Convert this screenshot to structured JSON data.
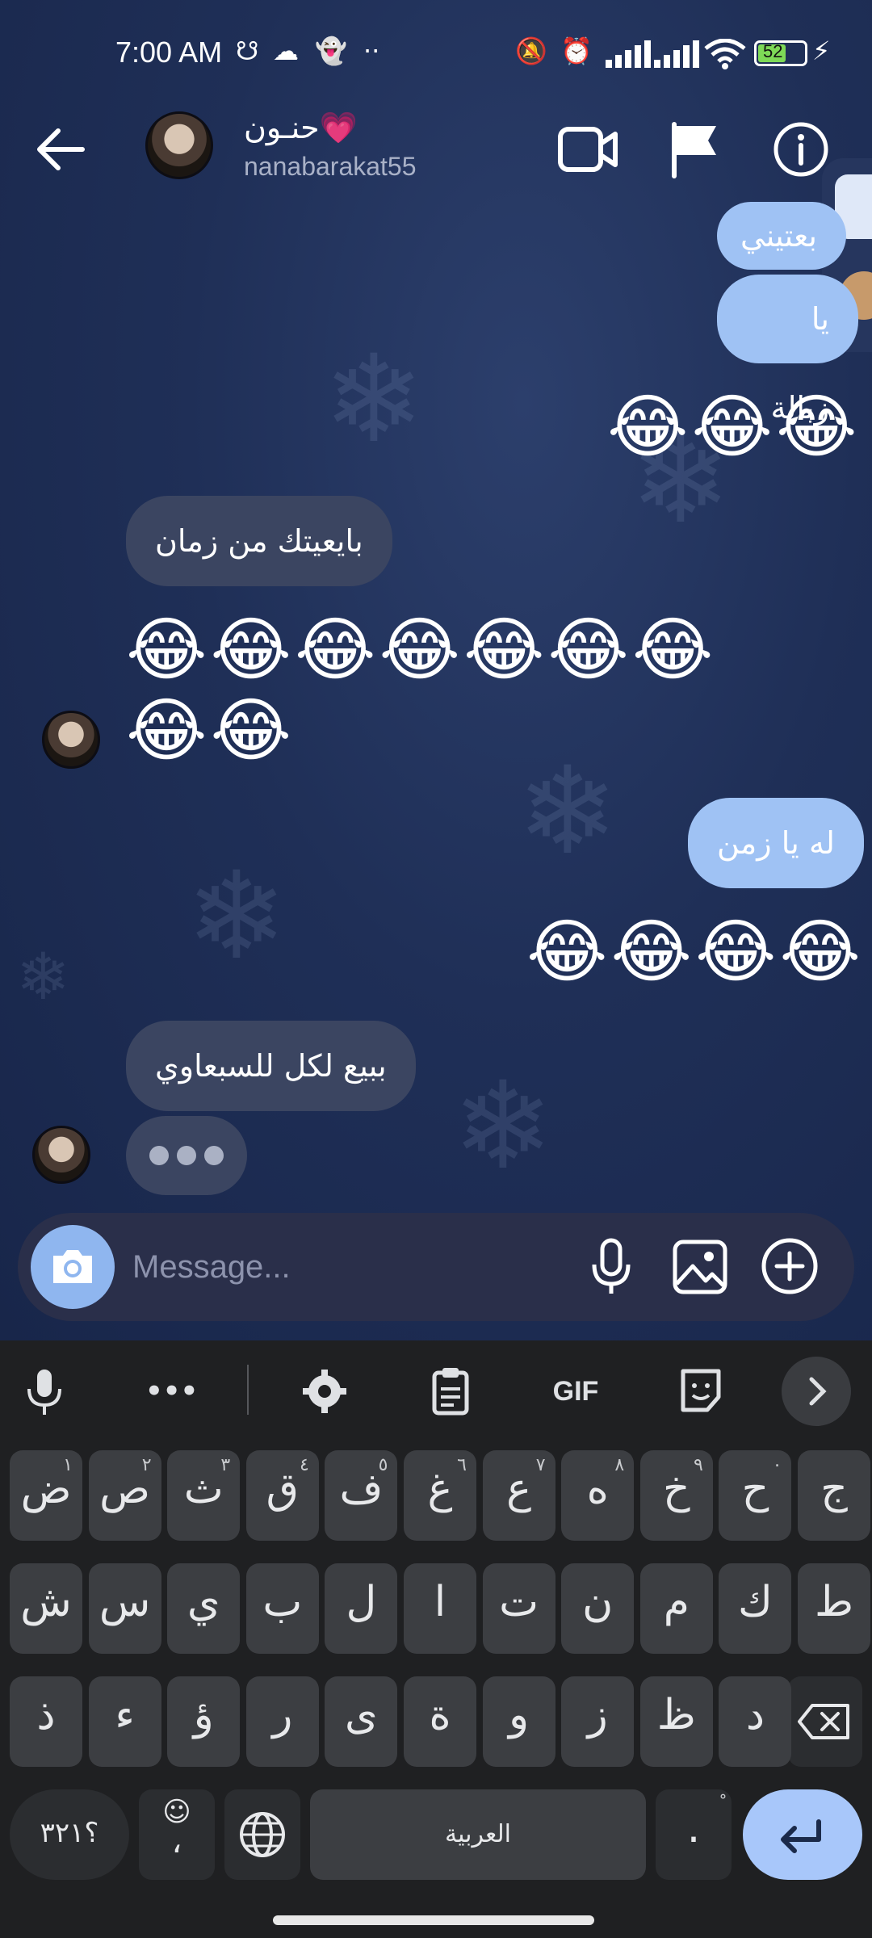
{
  "status_bar": {
    "time": "7:00 AM",
    "battery": "52"
  },
  "header": {
    "contact_name": "حنـون💗",
    "contact_username": "nanabarakat55"
  },
  "messages": {
    "out_1": "بعتيني",
    "out_2": "يا زبالة",
    "emoji_out_1": "😂😂😂",
    "in_1": "بايعيتك من زمان",
    "emoji_in_row1": "😂😂😂😂😂😂😂",
    "emoji_in_row2": "😂😂",
    "out_3": "له يا زمن",
    "emoji_out_2": "😂😂😂😂",
    "in_2": "ببيع لكل للسبعاوي"
  },
  "composer": {
    "placeholder": "Message..."
  },
  "keyboard": {
    "toolbar": {
      "gif_label": "GIF",
      "more_label": "•••"
    },
    "row1": [
      {
        "k": "ض",
        "h": "١"
      },
      {
        "k": "ص",
        "h": "٢"
      },
      {
        "k": "ث",
        "h": "٣"
      },
      {
        "k": "ق",
        "h": "٤"
      },
      {
        "k": "ف",
        "h": "٥"
      },
      {
        "k": "غ",
        "h": "٦"
      },
      {
        "k": "ع",
        "h": "٧"
      },
      {
        "k": "ه",
        "h": "٨"
      },
      {
        "k": "خ",
        "h": "٩"
      },
      {
        "k": "ح",
        "h": "٠"
      },
      {
        "k": "ج",
        "h": ""
      }
    ],
    "row2": [
      "ش",
      "س",
      "ي",
      "ب",
      "ل",
      "ا",
      "ت",
      "ن",
      "م",
      "ك",
      "ط"
    ],
    "row3": [
      "ذ",
      "ء",
      "ؤ",
      "ر",
      "ى",
      "ة",
      "و",
      "ز",
      "ظ",
      "د"
    ],
    "row4": {
      "numbers": "؟٣٢١",
      "emoji_comma": "،",
      "space": "العربية",
      "period": "."
    }
  },
  "colors": {
    "outgoing_bubble": "#9fc2f4",
    "incoming_bubble": "#3b4561",
    "accent": "#8fb6ef"
  }
}
